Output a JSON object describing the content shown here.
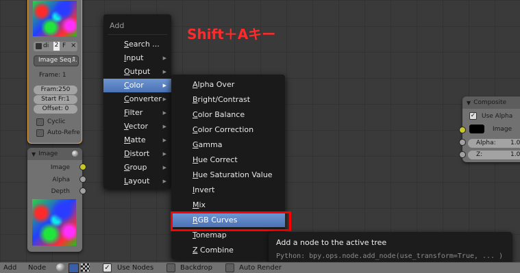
{
  "annotation": {
    "text": "Shift＋Aキー",
    "color": "#ff2b2b"
  },
  "left_node": {
    "buttons": [
      "di",
      "2",
      "F"
    ],
    "source_select": "Image Seq...",
    "frame_label": "Frame: 1",
    "fields": [
      "Fram:250",
      "Start Fr:1",
      "Offset: 0"
    ],
    "checkboxes": [
      "Cyclic",
      "Auto-Refre"
    ]
  },
  "image_node": {
    "title": "Image",
    "outputs": [
      "Image",
      "Alpha",
      "Depth"
    ]
  },
  "composite_node": {
    "title": "Composite",
    "use_alpha": "Use Alpha",
    "image_label": "Image",
    "fields": [
      {
        "label": "Alpha:",
        "value": "1.00"
      },
      {
        "label": "Z:",
        "value": "1.00"
      }
    ]
  },
  "add_menu": {
    "title": "Add",
    "items": [
      {
        "label": "Search ...",
        "mnemonic": "S",
        "rest": "earch ...",
        "submenu": false
      },
      {
        "label": "Input",
        "mnemonic": "I",
        "rest": "nput",
        "submenu": true
      },
      {
        "label": "Output",
        "mnemonic": "O",
        "rest": "utput",
        "submenu": true
      },
      {
        "label": "Color",
        "mnemonic": "C",
        "rest": "olor",
        "submenu": true
      },
      {
        "label": "Converter",
        "mnemonic": "C",
        "rest": "onverter",
        "submenu": true
      },
      {
        "label": "Filter",
        "mnemonic": "F",
        "rest": "ilter",
        "submenu": true
      },
      {
        "label": "Vector",
        "mnemonic": "V",
        "rest": "ector",
        "submenu": true
      },
      {
        "label": "Matte",
        "mnemonic": "M",
        "rest": "atte",
        "submenu": true
      },
      {
        "label": "Distort",
        "mnemonic": "D",
        "rest": "istort",
        "submenu": true
      },
      {
        "label": "Group",
        "mnemonic": "G",
        "rest": "roup",
        "submenu": true
      },
      {
        "label": "Layout",
        "mnemonic": "L",
        "rest": "ayout",
        "submenu": true
      }
    ],
    "active": "Color"
  },
  "color_submenu": {
    "items": [
      {
        "label": "Alpha Over",
        "mnemonic": "A",
        "rest": "lpha Over"
      },
      {
        "label": "Bright/Contrast",
        "mnemonic": "B",
        "rest": "right/Contrast"
      },
      {
        "label": "Color Balance",
        "mnemonic": "C",
        "rest": "olor Balance"
      },
      {
        "label": "Color Correction",
        "mnemonic": "C",
        "rest": "olor Correction"
      },
      {
        "label": "Gamma",
        "mnemonic": "G",
        "rest": "amma"
      },
      {
        "label": "Hue Correct",
        "mnemonic": "H",
        "rest": "ue Correct"
      },
      {
        "label": "Hue Saturation Value",
        "mnemonic": "H",
        "rest": "ue Saturation Value"
      },
      {
        "label": "Invert",
        "mnemonic": "I",
        "rest": "nvert"
      },
      {
        "label": "Mix",
        "mnemonic": "M",
        "rest": "ix"
      },
      {
        "label": "RGB Curves",
        "mnemonic": "R",
        "rest": "GB Curves"
      },
      {
        "label": "Tonemap",
        "mnemonic": "T",
        "rest": "onemap"
      },
      {
        "label": "Z Combine",
        "mnemonic": "Z",
        "rest": " Combine"
      }
    ],
    "active": "RGB Curves",
    "highlight_box_color": "#ff0000"
  },
  "tooltip": {
    "title": "Add a node to the active tree",
    "python": "Python: bpy.ops.node.add_node(use_transform=True, ... )"
  },
  "header": {
    "items": [
      "Add",
      "Node"
    ],
    "use_nodes": "Use Nodes",
    "backdrop": "Backdrop",
    "auto_render": "Auto Render"
  }
}
